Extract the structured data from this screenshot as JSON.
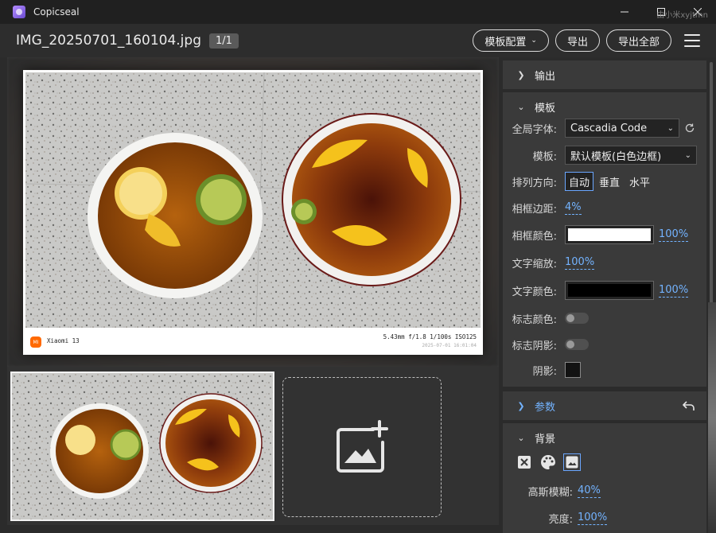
{
  "titlebar": {
    "app_name": "Copicseal",
    "watermark": "由小米xyjtmn"
  },
  "header": {
    "filename": "IMG_20250701_160104.jpg",
    "page_indicator": "1/1",
    "template_config_label": "模板配置",
    "export_label": "导出",
    "export_all_label": "导出全部"
  },
  "preview": {
    "brand_logo_text": "MI",
    "model": "Xiaomi 13",
    "exif": "5.43mm f/1.8 1/100s ISO125",
    "datetime": "2025-07-01 16:01:04"
  },
  "panel": {
    "output": {
      "title": "输出"
    },
    "template": {
      "title": "模板",
      "global_font_label": "全局字体:",
      "global_font_value": "Cascadia Code",
      "template_label": "模板:",
      "template_value": "默认模板(白色边框)",
      "direction_label": "排列方向:",
      "direction_options": [
        "自动",
        "垂直",
        "水平"
      ],
      "direction_selected": "自动",
      "frame_margin_label": "相框边距:",
      "frame_margin_value": "4%",
      "frame_color_label": "相框颜色:",
      "frame_color": "#ffffff",
      "frame_opacity": "100%",
      "text_scale_label": "文字缩放:",
      "text_scale_value": "100%",
      "text_color_label": "文字颜色:",
      "text_color": "#000000",
      "text_opacity": "100%",
      "logo_color_label": "标志颜色:",
      "logo_shadow_label": "标志阴影:",
      "shadow_label": "阴影:",
      "shadow_color": "#121212"
    },
    "params": {
      "title": "参数"
    },
    "background": {
      "title": "背景",
      "blur_label": "高斯模糊:",
      "blur_value": "40%",
      "brightness_label": "亮度:",
      "brightness_value": "100%"
    }
  },
  "colors": {
    "accent": "#73b3ff",
    "panel_bg": "#3a3a3a",
    "window_bg": "#2b2b2b"
  }
}
